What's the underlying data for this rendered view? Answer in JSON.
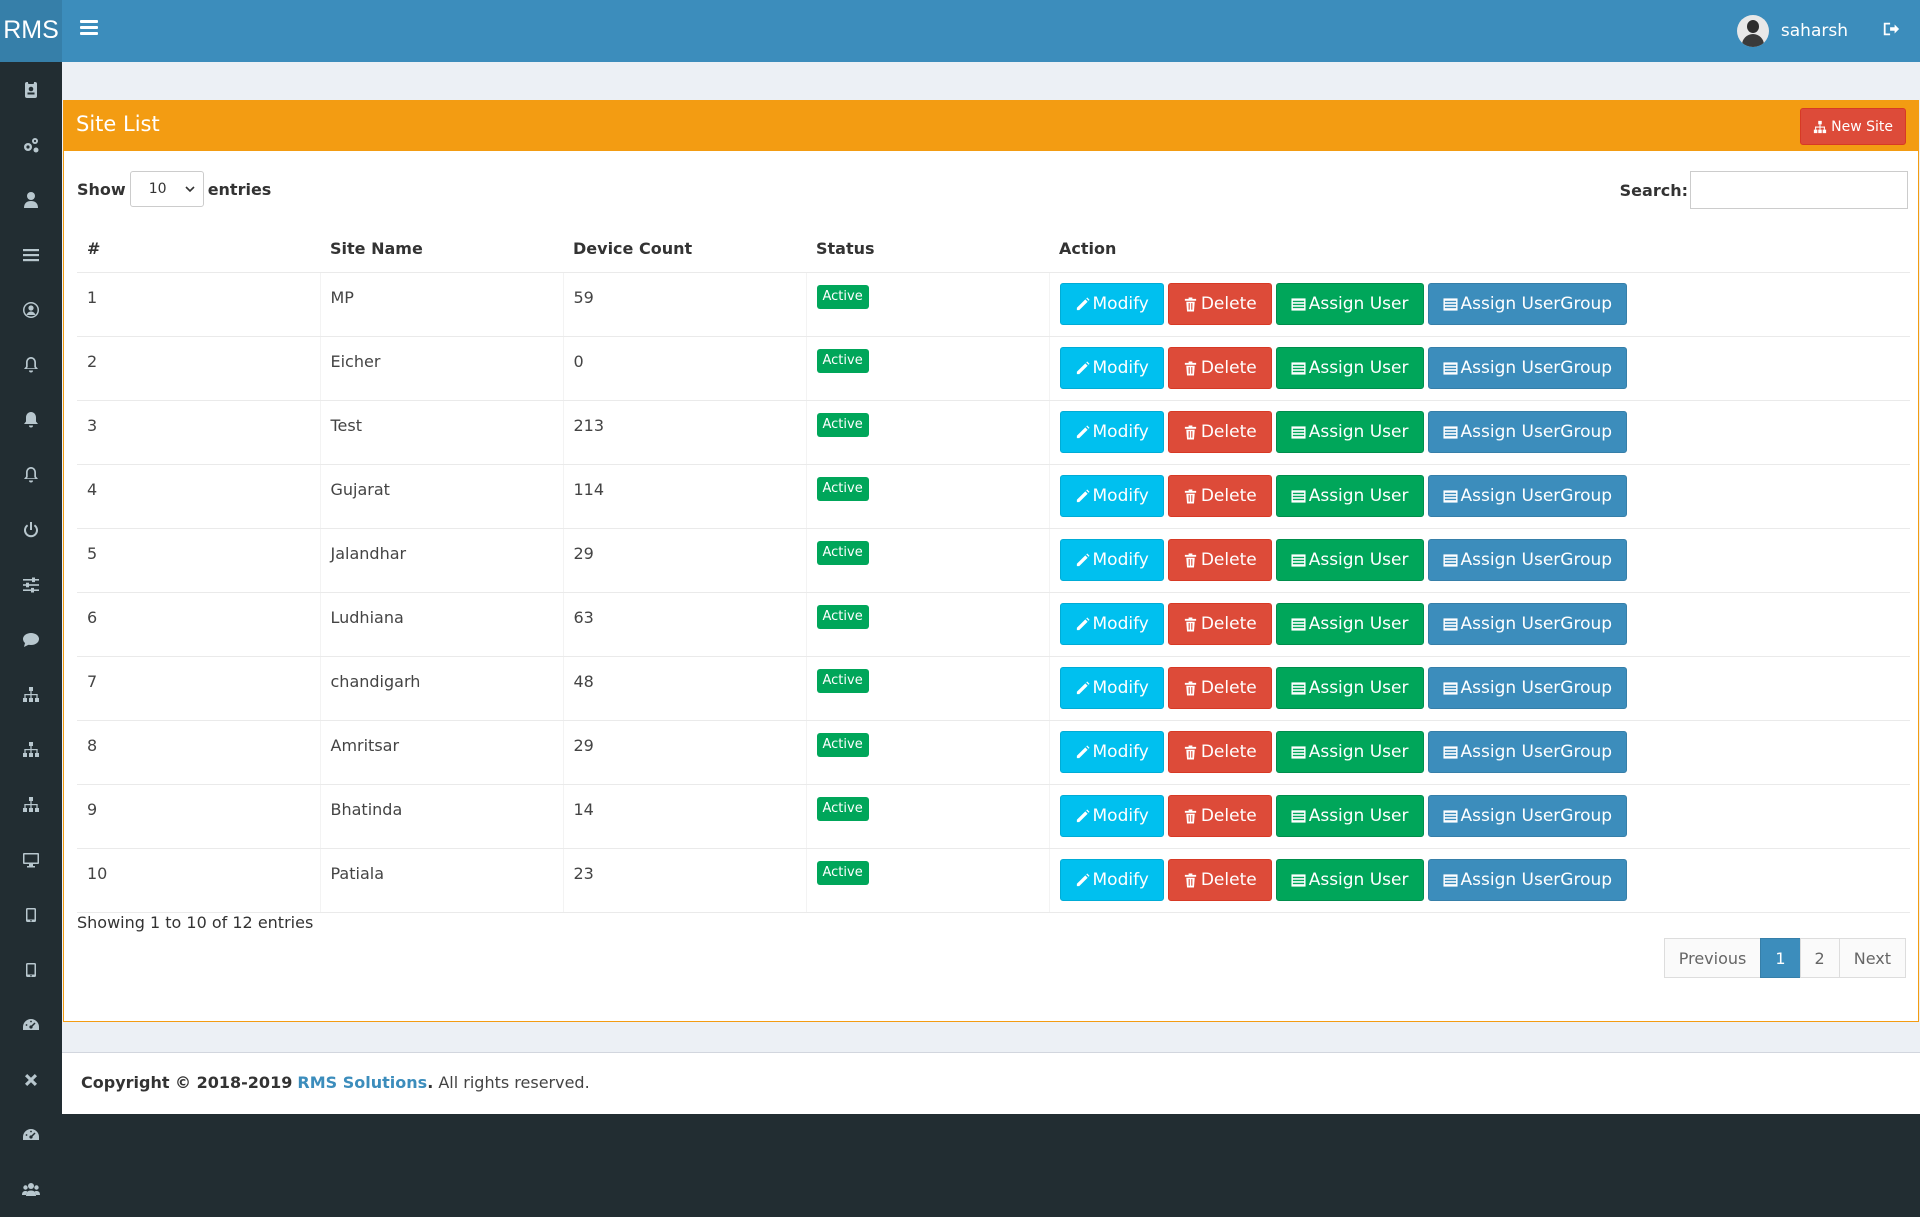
{
  "header": {
    "logo": "RMS",
    "username": "saharsh"
  },
  "sidebar": {
    "items": [
      {
        "icon": "id-badge-icon"
      },
      {
        "icon": "cogs-icon"
      },
      {
        "icon": "user-icon"
      },
      {
        "icon": "list-icon"
      },
      {
        "icon": "user-circle-icon"
      },
      {
        "icon": "bell-outline-icon"
      },
      {
        "icon": "bell-icon"
      },
      {
        "icon": "bell-outline-icon"
      },
      {
        "icon": "power-icon"
      },
      {
        "icon": "sliders-icon"
      },
      {
        "icon": "comment-icon"
      },
      {
        "icon": "sitemap-icon"
      },
      {
        "icon": "sitemap-icon"
      },
      {
        "icon": "sitemap-icon"
      },
      {
        "icon": "desktop-icon"
      },
      {
        "icon": "tablet-icon"
      },
      {
        "icon": "tablet-icon"
      },
      {
        "icon": "dashboard-icon"
      },
      {
        "icon": "close-icon"
      },
      {
        "icon": "dashboard-icon"
      },
      {
        "icon": "users-icon"
      }
    ]
  },
  "box": {
    "title": "Site List",
    "new_site_label": "New Site"
  },
  "controls": {
    "show_label": "Show",
    "entries_value": "10",
    "entries_label": "entries",
    "search_label": "Search:",
    "search_value": ""
  },
  "table": {
    "headers": {
      "num": "#",
      "site": "Site Name",
      "count": "Device Count",
      "status": "Status",
      "action": "Action"
    },
    "actions": {
      "modify": "Modify",
      "delete": "Delete",
      "assign_user": "Assign User",
      "assign_usergroup": "Assign UserGroup"
    },
    "rows": [
      {
        "num": "1",
        "site": "MP",
        "count": "59",
        "status": "Active"
      },
      {
        "num": "2",
        "site": "Eicher",
        "count": "0",
        "status": "Active"
      },
      {
        "num": "3",
        "site": "Test",
        "count": "213",
        "status": "Active"
      },
      {
        "num": "4",
        "site": "Gujarat",
        "count": "114",
        "status": "Active"
      },
      {
        "num": "5",
        "site": "Jalandhar",
        "count": "29",
        "status": "Active"
      },
      {
        "num": "6",
        "site": "Ludhiana",
        "count": "63",
        "status": "Active"
      },
      {
        "num": "7",
        "site": "chandigarh",
        "count": "48",
        "status": "Active"
      },
      {
        "num": "8",
        "site": "Amritsar",
        "count": "29",
        "status": "Active"
      },
      {
        "num": "9",
        "site": "Bhatinda",
        "count": "14",
        "status": "Active"
      },
      {
        "num": "10",
        "site": "Patiala",
        "count": "23",
        "status": "Active"
      }
    ]
  },
  "info": "Showing 1 to 10 of 12 entries",
  "pagination": {
    "previous": "Previous",
    "pages": [
      "1",
      "2"
    ],
    "current": "1",
    "next": "Next"
  },
  "footer": {
    "prefix": "Copyright © 2018-2019",
    "brand": "RMS Solutions",
    "suffix": ". All rights reserved."
  },
  "colors": {
    "header": "#3c8dbc",
    "box_header": "#f39c12",
    "sidebar": "#222d32",
    "modify": "#00c0ef",
    "delete": "#dd4b39",
    "assign_user": "#00a65a",
    "assign_usergroup": "#3c8dbc"
  }
}
